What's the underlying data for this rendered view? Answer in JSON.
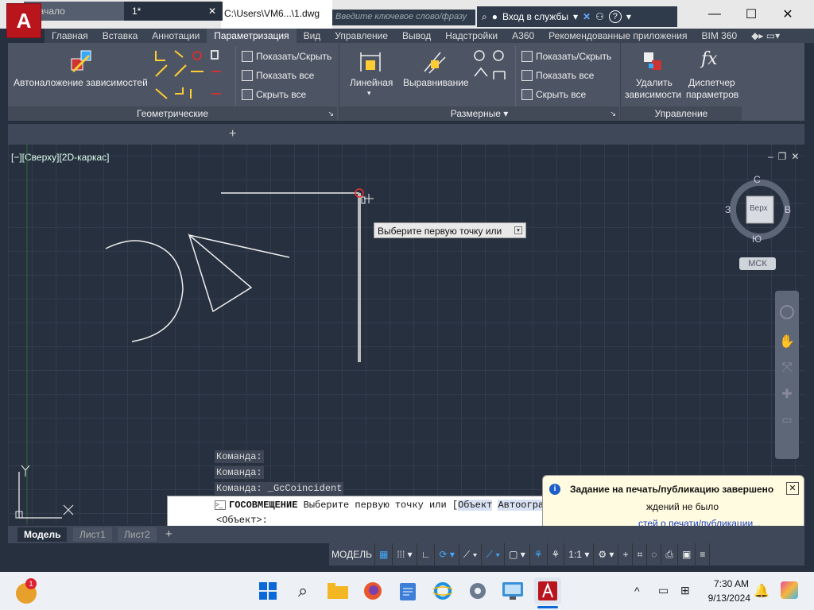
{
  "titlebar": {
    "file_title": "C:\\Users\\VM6...\\1.dwg",
    "search_placeholder": "Введите ключевое слово/фразу",
    "signin_label": "Вход в службы",
    "help_icon": "?",
    "app_logo": "A"
  },
  "ribbon_tabs": [
    "Главная",
    "Вставка",
    "Аннотации",
    "Параметризация",
    "Вид",
    "Управление",
    "Вывод",
    "Надстройки",
    "A360",
    "Рекомендованные приложения",
    "BIM 360"
  ],
  "ribbon_active_tab": "Параметризация",
  "ribbon": {
    "auto_constrain": "Автоналожение зависимостей",
    "geom_show_hide": "Показать/Скрыть",
    "geom_show_all": "Показать все",
    "geom_hide_all": "Скрыть все",
    "linear": "Линейная",
    "aligned": "Выравнивание",
    "dim_show_hide": "Показать/Скрыть",
    "dim_show_all": "Показать все",
    "dim_hide_all": "Скрыть все",
    "delete_constraints_l1": "Удалить",
    "delete_constraints_l2": "зависимости",
    "param_manager_l1": "Диспетчер",
    "param_manager_l2": "параметров",
    "panel_geometric": "Геометрические",
    "panel_dimensional": "Размерные",
    "panel_manage": "Управление"
  },
  "doc_tabs": {
    "start": "Начало",
    "drawing": "1*"
  },
  "viewport": {
    "label": "[−][Сверху][2D-каркас]",
    "tooltip": "Выберите первую точку или",
    "viewcube": {
      "north": "С",
      "south": "Ю",
      "west": "З",
      "east": "В",
      "face": "Верх"
    },
    "wcs": "МСК"
  },
  "command": {
    "history": [
      "Команда:",
      "Команда:",
      "Команда: _GcCoincident"
    ],
    "cmd_name": "ГОСОВМЕЩЕНИЕ",
    "prompt": "Выберите первую точку или [",
    "opt1": "Объект",
    "opt2": "Автоограничение",
    "prompt_end": "]",
    "line2": "<Объект>:"
  },
  "notification": {
    "title": "Задание на печать/публикацию завершено",
    "line1": "ждений не было",
    "link": "стей о печати/публикации..."
  },
  "layout_tabs": [
    "Модель",
    "Лист1",
    "Лист2"
  ],
  "status": {
    "model": "МОДЕЛЬ",
    "scale": "1:1"
  },
  "taskbar": {
    "time": "7:30 AM",
    "date": "9/13/2024",
    "badge": "1"
  },
  "colors": {
    "accent_red": "#b8151c",
    "canvas": "#27303f",
    "ribbon": "#4d5564"
  }
}
